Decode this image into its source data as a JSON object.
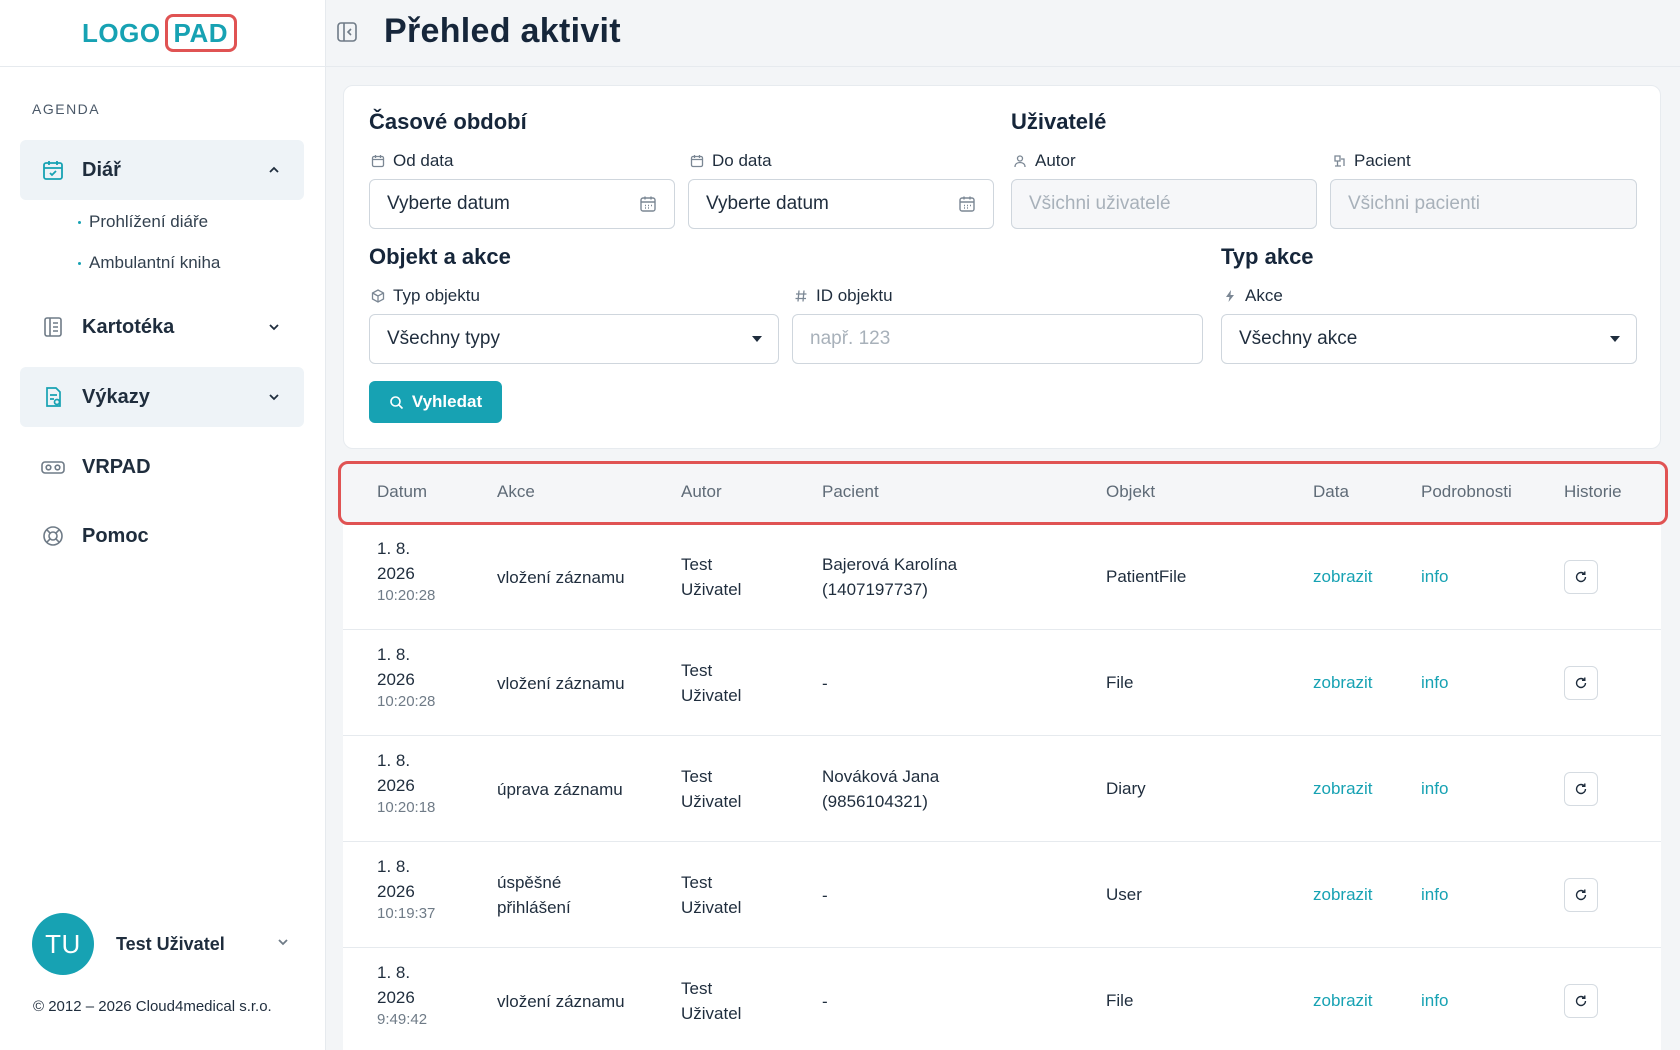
{
  "brand": {
    "logo_part1": "LOGO",
    "logo_part2": "PAD",
    "accent": "#17a2b3",
    "highlight": "#e05353"
  },
  "sidebar": {
    "section_label": "AGENDA",
    "items": [
      {
        "label": "Diář",
        "icon": "calendar-check-icon",
        "expanded": true,
        "children": [
          {
            "label": "Prohlížení diáře"
          },
          {
            "label": "Ambulantní kniha"
          }
        ]
      },
      {
        "label": "Kartotéka",
        "icon": "address-book-icon"
      },
      {
        "label": "Výkazy",
        "icon": "report-icon"
      },
      {
        "label": "VRPAD",
        "icon": "vr-headset-icon"
      },
      {
        "label": "Pomoc",
        "icon": "lifebuoy-icon"
      }
    ],
    "user": {
      "initials": "TU",
      "name": "Test Uživatel"
    },
    "copyright": "© 2012 – 2026 Cloud4medical s.r.o."
  },
  "header": {
    "title": "Přehled aktivit"
  },
  "filters": {
    "period": {
      "title": "Časové období",
      "from": {
        "label": "Od data",
        "value": "Vyberte datum"
      },
      "to": {
        "label": "Do data",
        "value": "Vyberte datum"
      }
    },
    "users": {
      "title": "Uživatelé",
      "author": {
        "label": "Autor",
        "placeholder": "Všichni uživatelé"
      },
      "patient": {
        "label": "Pacient",
        "placeholder": "Všichni pacienti"
      }
    },
    "object": {
      "title": "Objekt a akce",
      "type": {
        "label": "Typ objektu",
        "value": "Všechny typy"
      },
      "id": {
        "label": "ID objektu",
        "placeholder": "např. 123"
      }
    },
    "action_type": {
      "title": "Typ akce",
      "action": {
        "label": "Akce",
        "value": "Všechny akce"
      }
    },
    "search_label": "Vyhledat"
  },
  "table": {
    "columns": [
      "Datum",
      "Akce",
      "Autor",
      "Pacient",
      "Objekt",
      "Data",
      "Podrobnosti",
      "Historie"
    ],
    "rows": [
      {
        "date": "1. 8.",
        "year": "2026",
        "time": "10:20:28",
        "action": [
          "vložení záznamu"
        ],
        "author": [
          "Test",
          "Uživatel"
        ],
        "patient": [
          "Bajerová Karolína",
          "(1407197737)"
        ],
        "object": "PatientFile",
        "data": "zobrazit",
        "details": "info"
      },
      {
        "date": "1. 8.",
        "year": "2026",
        "time": "10:20:28",
        "action": [
          "vložení záznamu"
        ],
        "author": [
          "Test",
          "Uživatel"
        ],
        "patient": [
          "-"
        ],
        "object": "File",
        "data": "zobrazit",
        "details": "info"
      },
      {
        "date": "1. 8.",
        "year": "2026",
        "time": "10:20:18",
        "action": [
          "úprava záznamu"
        ],
        "author": [
          "Test",
          "Uživatel"
        ],
        "patient": [
          "Nováková Jana",
          "(9856104321)"
        ],
        "object": "Diary",
        "data": "zobrazit",
        "details": "info"
      },
      {
        "date": "1. 8.",
        "year": "2026",
        "time": "10:19:37",
        "action": [
          "úspěšné",
          "přihlášení"
        ],
        "author": [
          "Test",
          "Uživatel"
        ],
        "patient": [
          "-"
        ],
        "object": "User",
        "data": "zobrazit",
        "details": "info"
      },
      {
        "date": "1. 8.",
        "year": "2026",
        "time": "9:49:42",
        "action": [
          "vložení záznamu"
        ],
        "author": [
          "Test",
          "Uživatel"
        ],
        "patient": [
          "-"
        ],
        "object": "File",
        "data": "zobrazit",
        "details": "info"
      }
    ]
  }
}
